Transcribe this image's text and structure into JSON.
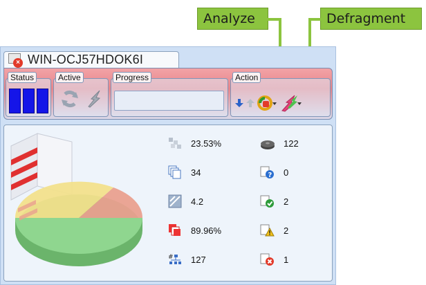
{
  "callouts": {
    "analyze": "Analyze",
    "defragment": "Defragment"
  },
  "colors": {
    "callout_green": "#8cc43f",
    "band_red": "#e7868c",
    "status_blue": "#1515e8",
    "panel_blue": "#cfe0f5"
  },
  "widget": {
    "title": "WIN-OCJ57HDOK6I",
    "title_icon": "computer-error-icon",
    "groups": {
      "status": "Status",
      "active": "Active",
      "progress": "Progress",
      "action": "Action"
    },
    "action_icons": [
      "move-down-icon",
      "move-up-icon",
      "analyze-dropdown-icon",
      "defragment-dropdown-icon"
    ]
  },
  "stats": {
    "left": [
      {
        "icon": "fragmentation-icon",
        "value": "23.53%"
      },
      {
        "icon": "files-icon",
        "value": "34"
      },
      {
        "icon": "fragments-icon",
        "value": "4.2"
      },
      {
        "icon": "fragmented-percent-icon",
        "value": "89.96%"
      },
      {
        "icon": "hierarchy-icon",
        "value": "127"
      }
    ],
    "right": [
      {
        "icon": "disk-icon",
        "value": "122"
      },
      {
        "icon": "question-icon",
        "value": "0"
      },
      {
        "icon": "check-icon",
        "value": "2"
      },
      {
        "icon": "warning-icon",
        "value": "2"
      },
      {
        "icon": "error-icon",
        "value": "1"
      }
    ]
  }
}
